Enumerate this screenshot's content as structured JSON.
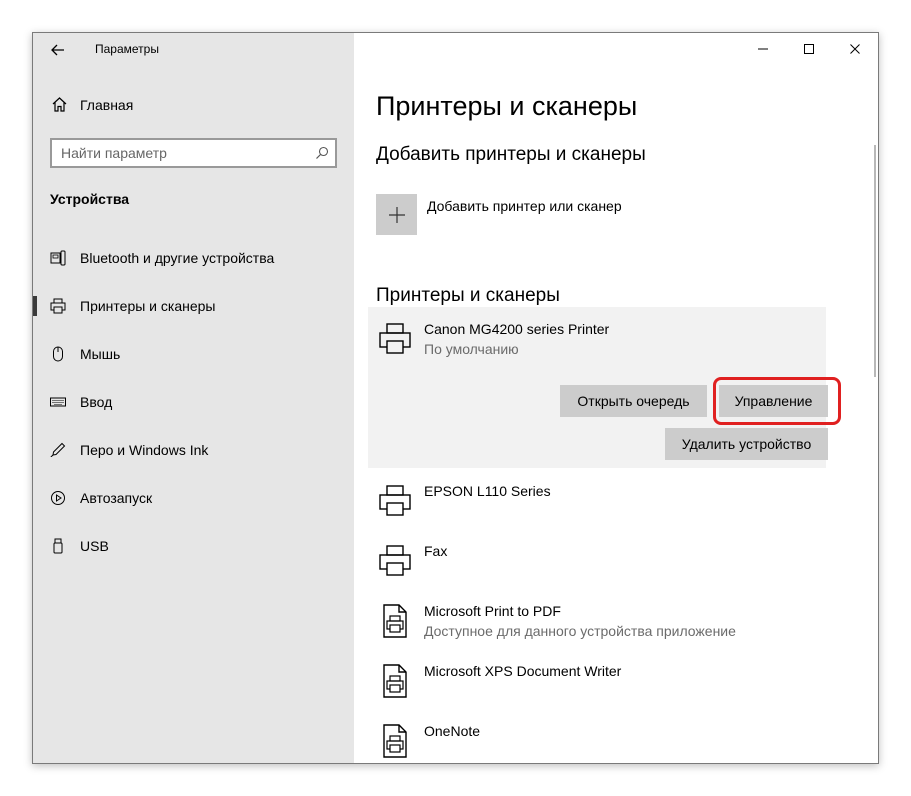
{
  "window": {
    "title": "Параметры",
    "controls": [
      "minimize-icon",
      "maximize-icon",
      "close-icon"
    ]
  },
  "sidebar": {
    "home_label": "Главная",
    "search_placeholder": "Найти параметр",
    "section_title": "Устройства",
    "items": [
      {
        "label": "Bluetooth и другие устройства",
        "icon": "bluetooth-devices-icon",
        "active": false
      },
      {
        "label": "Принтеры и сканеры",
        "icon": "printer-icon",
        "active": true
      },
      {
        "label": "Мышь",
        "icon": "mouse-icon",
        "active": false
      },
      {
        "label": "Ввод",
        "icon": "keyboard-icon",
        "active": false
      },
      {
        "label": "Перо и Windows Ink",
        "icon": "pen-icon",
        "active": false
      },
      {
        "label": "Автозапуск",
        "icon": "autoplay-icon",
        "active": false
      },
      {
        "label": "USB",
        "icon": "usb-icon",
        "active": false
      }
    ]
  },
  "main": {
    "title": "Принтеры и сканеры",
    "add_section_title": "Добавить принтеры и сканеры",
    "add_button_label": "Добавить принтер или сканер",
    "printers_section_title": "Принтеры и сканеры",
    "selected_printer": {
      "name": "Canon MG4200 series Printer",
      "status": "По умолчанию",
      "buttons": {
        "open_queue": "Открыть очередь",
        "manage": "Управление",
        "remove": "Удалить устройство"
      }
    },
    "printers": [
      {
        "name": "EPSON L110 Series",
        "status": "",
        "icon": "printer-icon"
      },
      {
        "name": "Fax",
        "status": "",
        "icon": "printer-icon"
      },
      {
        "name": "Microsoft Print to PDF",
        "status": "Доступное для данного устройства приложение",
        "icon": "print-document-icon"
      },
      {
        "name": "Microsoft XPS Document Writer",
        "status": "",
        "icon": "print-document-icon"
      },
      {
        "name": "OneNote",
        "status": "",
        "icon": "print-document-icon"
      }
    ]
  },
  "colors": {
    "sidebar_bg": "#e6e6e6",
    "selected_card_bg": "#f2f2f2",
    "button_bg": "#cccccc",
    "highlight": "#e02020"
  }
}
